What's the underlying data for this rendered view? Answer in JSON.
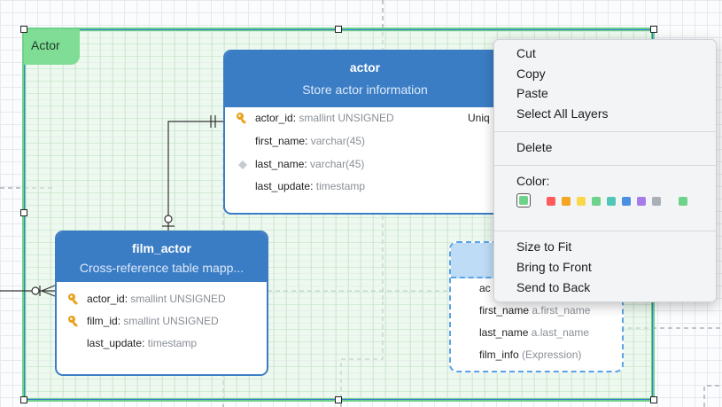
{
  "layer": {
    "name": "Actor"
  },
  "actor_table": {
    "title": "actor",
    "subtitle": "Store actor information",
    "columns": [
      {
        "name": "actor_id",
        "type": "smallint UNSIGNED",
        "extra": "Uniq"
      },
      {
        "name": "first_name",
        "type": "varchar(45)"
      },
      {
        "name": "last_name",
        "type": "varchar(45)"
      },
      {
        "name": "last_update",
        "type": "timestamp"
      }
    ]
  },
  "film_actor_table": {
    "title": "film_actor",
    "subtitle": "Cross-reference table mapp...",
    "columns": [
      {
        "name": "actor_id",
        "type": "smallint UNSIGNED"
      },
      {
        "name": "film_id",
        "type": "smallint UNSIGNED"
      },
      {
        "name": "last_update",
        "type": "timestamp"
      }
    ]
  },
  "view_table": {
    "columns": [
      {
        "name": "ac",
        "type": ""
      },
      {
        "name": "first_name",
        "type": "a.first_name"
      },
      {
        "name": "last_name",
        "type": "a.last_name"
      },
      {
        "name": "film_info",
        "type": "(Expression)"
      }
    ]
  },
  "context_menu": {
    "cut": "Cut",
    "copy": "Copy",
    "paste": "Paste",
    "select_all": "Select All Layers",
    "delete": "Delete",
    "color_label": "Color:",
    "size_to_fit": "Size to Fit",
    "bring_to_front": "Bring to Front",
    "send_to_back": "Send to Back",
    "colors": [
      "#6fd28a",
      "#ff5b5b",
      "#f5a623",
      "#f8d94a",
      "#6fd28a",
      "#52c7b8",
      "#4a90e2",
      "#a77be8",
      "#a9b0b8",
      "#6fd28a"
    ]
  },
  "colors": {
    "accent": "#3b7dc4",
    "layer": "#6fd28a",
    "key": "#e8a21a"
  }
}
